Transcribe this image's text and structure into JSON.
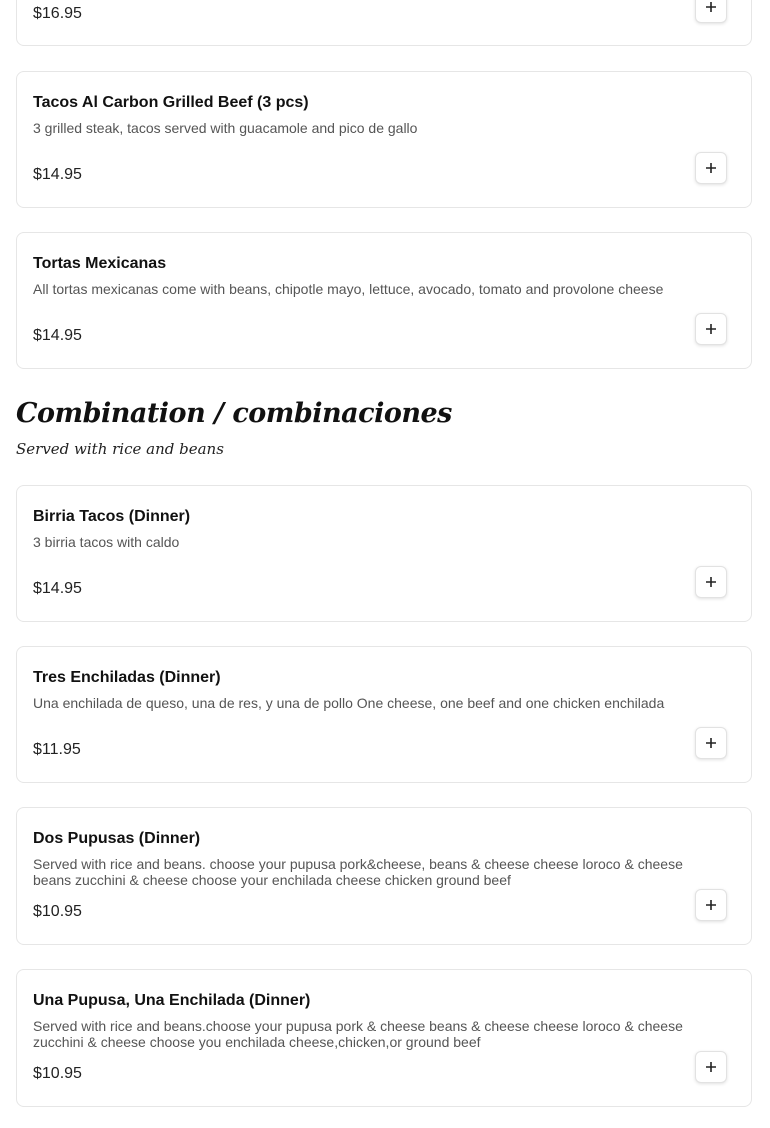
{
  "top_partial": {
    "price": "$16.95"
  },
  "items": [
    {
      "name": "Tacos Al Carbon Grilled Beef (3 pcs)",
      "description": "3 grilled steak, tacos served with guacamole and pico de gallo",
      "price": "$14.95"
    },
    {
      "name": "Tortas Mexicanas",
      "description": "All tortas mexicanas come with beans, chipotle mayo, lettuce, avocado, tomato and provolone cheese",
      "price": "$14.95"
    }
  ],
  "section": {
    "title": "Combination / combinaciones",
    "subtitle": "Served with rice and beans",
    "items": [
      {
        "name": "Birria Tacos (Dinner)",
        "description": "3 birria tacos with caldo",
        "price": "$14.95"
      },
      {
        "name": "Tres Enchiladas (Dinner)",
        "description": "Una enchilada de queso, una de res, y una de pollo One cheese, one beef and one chicken enchilada",
        "price": "$11.95"
      },
      {
        "name": "Dos Pupusas (Dinner)",
        "description": "Served with rice and beans. choose your pupusa pork&cheese, beans & cheese cheese loroco & cheese beans zucchini & cheese choose your enchilada cheese chicken ground beef",
        "price": "$10.95"
      },
      {
        "name": "Una Pupusa, Una Enchilada (Dinner)",
        "description": "Served with rice and beans.choose your pupusa pork & cheese beans & cheese cheese loroco & cheese zucchini & cheese choose you enchilada cheese,chicken,or ground beef",
        "price": "$10.95"
      }
    ]
  },
  "icons": {
    "add": "plus-icon"
  }
}
